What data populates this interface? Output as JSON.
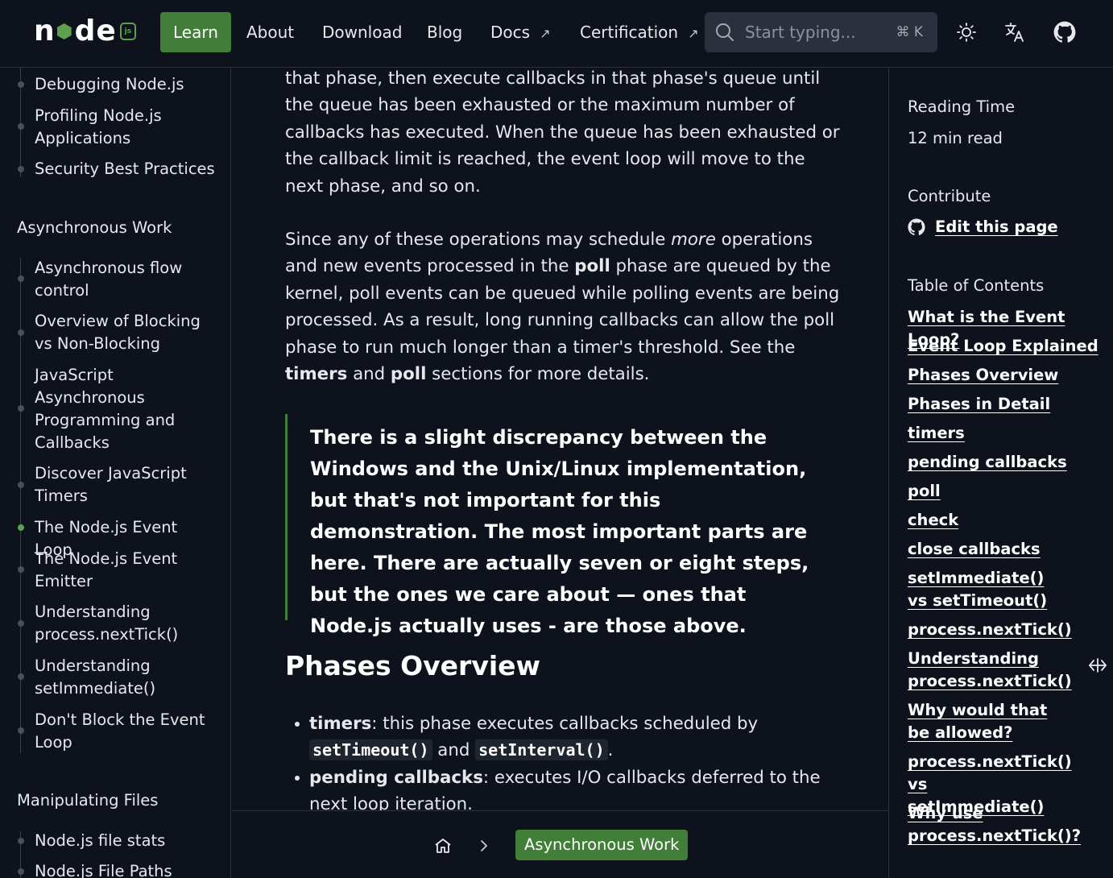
{
  "nav": {
    "logo_letters": [
      "n",
      "d",
      "e"
    ],
    "logo_badge": "js",
    "items": [
      {
        "label": "Learn",
        "active": true
      },
      {
        "label": "About"
      },
      {
        "label": "Download"
      },
      {
        "label": "Blog"
      },
      {
        "label": "Docs",
        "external": true
      },
      {
        "label": "Certification",
        "external": true
      }
    ],
    "external_glyph": "↗",
    "search_placeholder": "Start typing...",
    "search_shortcut": "⌘ K",
    "icons": [
      "sun-icon",
      "translate-icon",
      "github-icon"
    ]
  },
  "sidebar": {
    "items_top": [
      "Debugging Node.js",
      "Profiling Node.js Applications",
      "Security Best Practices"
    ],
    "group_async": "Asynchronous Work",
    "items_async": [
      "Asynchronous flow control",
      "Overview of Blocking vs Non-Blocking",
      "JavaScript Asynchronous Programming and Callbacks",
      "Discover JavaScript Timers",
      "The Node.js Event Loop",
      "The Node.js Event Emitter",
      "Understanding process.nextTick()",
      "Understanding setImmediate()",
      "Don't Block the Event Loop"
    ],
    "active_item": "The Node.js Event Loop",
    "group_files": "Manipulating Files",
    "items_files": [
      "Node.js file stats",
      "Node.js File Paths"
    ]
  },
  "content": {
    "p1": "that phase, then execute callbacks in that phase's queue until the queue has been exhausted or the maximum number of callbacks has executed. When the queue has been exhausted or the callback limit is reached, the event loop will move to the next phase, and so on.",
    "p2": {
      "a": "Since any of these operations may schedule ",
      "b": "more",
      "c": " operations and new events processed in the ",
      "d": "poll",
      "e": " phase are queued by the kernel, poll events can be queued while polling events are being processed. As a result, long running callbacks can allow the poll phase to run much longer than a timer's threshold. See the ",
      "f": "timers",
      "g": " and ",
      "h": "poll",
      "i": " sections for more details."
    },
    "quote": "There is a slight discrepancy between the Windows and the Unix/Linux implementation, but that's not important for this demonstration. The most important parts are here. There are actually seven or eight steps, but the ones we care about — ones that Node.js actually uses - are those above.",
    "heading": "Phases Overview",
    "b1": {
      "term": "timers",
      "text": ": this phase executes callbacks scheduled by ",
      "code1": "setTimeout()",
      "and": " and ",
      "code2": "setInterval()",
      "end": "."
    },
    "b2": {
      "term": "pending callbacks",
      "text": ": executes I/O callbacks deferred to the next loop iteration."
    }
  },
  "breadcrumb": {
    "current": "Asynchronous Work"
  },
  "rail": {
    "reading_time_label": "Reading Time",
    "reading_time_value": "12 min read",
    "contribute_label": "Contribute",
    "edit_label": "Edit this page",
    "toc_label": "Table of Contents",
    "toc": [
      "What is the Event Loop?",
      "Event Loop Explained",
      "Phases Overview",
      "Phases in Detail",
      "timers",
      "pending callbacks",
      "poll",
      "check",
      "close callbacks",
      "setImmediate() vs setTimeout()",
      "process.nextTick()",
      "Understanding process.nextTick()",
      "Why would that be allowed?",
      "process.nextTick() vs setImmediate()",
      "Why use process.nextTick()?"
    ]
  },
  "colors": {
    "accent": "#417e38",
    "brand": "#5fa04e",
    "bg": "#0d121c",
    "border": "#2c3340"
  }
}
